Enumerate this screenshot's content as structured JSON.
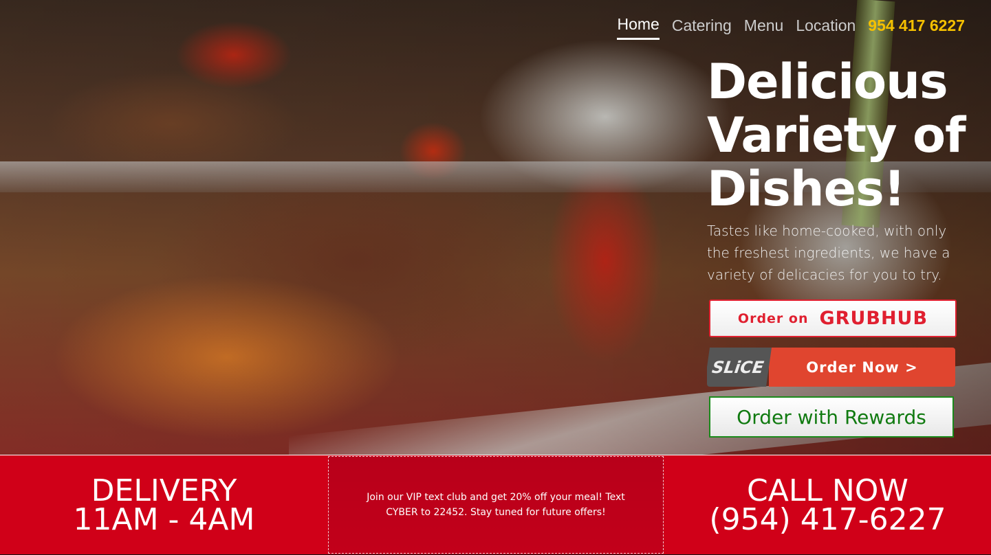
{
  "nav": {
    "items": [
      {
        "label": "Home",
        "active": true
      },
      {
        "label": "Catering",
        "active": false
      },
      {
        "label": "Menu",
        "active": false
      },
      {
        "label": "Location",
        "active": false
      }
    ],
    "phone": "954 417 6227"
  },
  "hero": {
    "headline": "Delicious Variety of Dishes!",
    "tagline": "Tastes like home-cooked, with only the freshest ingredients, we have a variety of delicacies for you to try.",
    "background_icon": "food-photo"
  },
  "order_buttons": {
    "grubhub": {
      "prefix": "Order on",
      "brand": "GRUBHUB"
    },
    "slice": {
      "logo": "SLiCE",
      "label": "Order Now >"
    },
    "rewards": {
      "label": "Order with Rewards"
    }
  },
  "info_band": {
    "delivery_title": "DELIVERY",
    "delivery_hours": "11AM - 4AM",
    "promo_text": "Join our VIP text club and get 20% off your meal! Text CYBER to 22452. Stay tuned for future offers!",
    "call_title": "CALL NOW",
    "call_phone": "(954) 417-6227"
  },
  "colors": {
    "accent_red": "#d00018",
    "phone_yellow": "#f5c000",
    "grubhub_red": "#e02030",
    "slice_orange": "#e0452f",
    "rewards_green": "#107a10"
  }
}
